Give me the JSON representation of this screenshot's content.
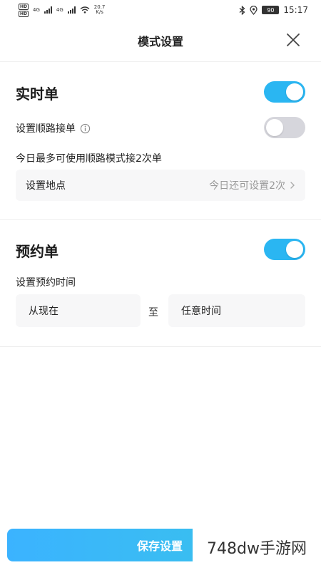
{
  "status_bar": {
    "hd1": "HD",
    "hd2": "HD",
    "net1": "4G",
    "net2": "4G",
    "speed_value": "20.7",
    "speed_unit": "K/s",
    "battery": "90",
    "time": "15:17"
  },
  "header": {
    "title": "模式设置",
    "close_icon": "close-icon"
  },
  "realtime": {
    "title": "实时单",
    "toggle_on": true,
    "shunlu_label": "设置顺路接单",
    "shunlu_toggle_on": false,
    "limit_text": "今日最多可使用顺路模式接2次单",
    "location_label": "设置地点",
    "location_remaining": "今日还可设置2次"
  },
  "reservation": {
    "title": "预约单",
    "toggle_on": true,
    "time_label": "设置预约时间",
    "from_value": "从现在",
    "to_label": "至",
    "to_value": "任意时间"
  },
  "footer": {
    "save_label": "保存设置",
    "watermark": "748dw手游网"
  },
  "colors": {
    "accent": "#2ab6f2",
    "toggle_off": "#d6d6dc",
    "box_bg": "#f7f7f8"
  }
}
